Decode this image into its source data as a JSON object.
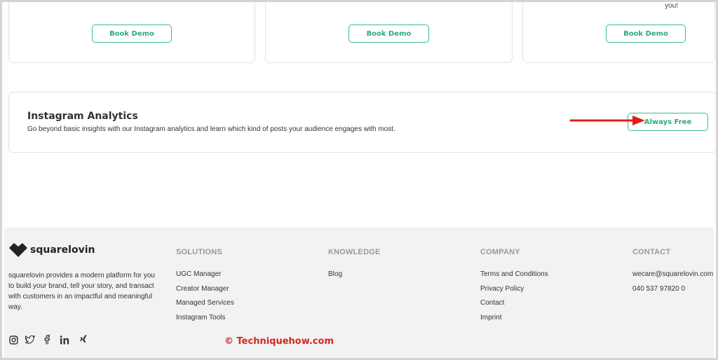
{
  "cards": [
    {
      "button_label": "Book Demo",
      "note": ""
    },
    {
      "button_label": "Book Demo",
      "note": ""
    },
    {
      "button_label": "Book Demo",
      "note": "you!"
    }
  ],
  "analytics": {
    "title": "Instagram Analytics",
    "description": "Go beyond basic insights with our Instagram analytics and learn which kind of posts your audience engages with most.",
    "button_label": "Always Free"
  },
  "footer": {
    "brand": "squarelovin",
    "about": "squarelovin provides a modern platform for you to build your brand, tell your story, and transact with customers in an impactful and meaningful way.",
    "columns": [
      {
        "heading": "SOLUTIONS",
        "items": [
          "UGC Manager",
          "Creator Manager",
          "Managed Services",
          "Instagram Tools"
        ]
      },
      {
        "heading": "KNOWLEDGE",
        "items": [
          "Blog"
        ]
      },
      {
        "heading": "COMPANY",
        "items": [
          "Terms and Conditions",
          "Privacy Policy",
          "Contact",
          "Imprint"
        ]
      },
      {
        "heading": "CONTACT",
        "items": [
          "wecare@squarelovin.com",
          "040 537 97820 0"
        ]
      }
    ],
    "social_icons": [
      "instagram-icon",
      "twitter-icon",
      "facebook-icon",
      "linkedin-icon",
      "xing-icon"
    ]
  },
  "watermark": "© Techniquehow.com",
  "colors": {
    "accent": "#3db79a",
    "arrow": "#e51c1c"
  }
}
